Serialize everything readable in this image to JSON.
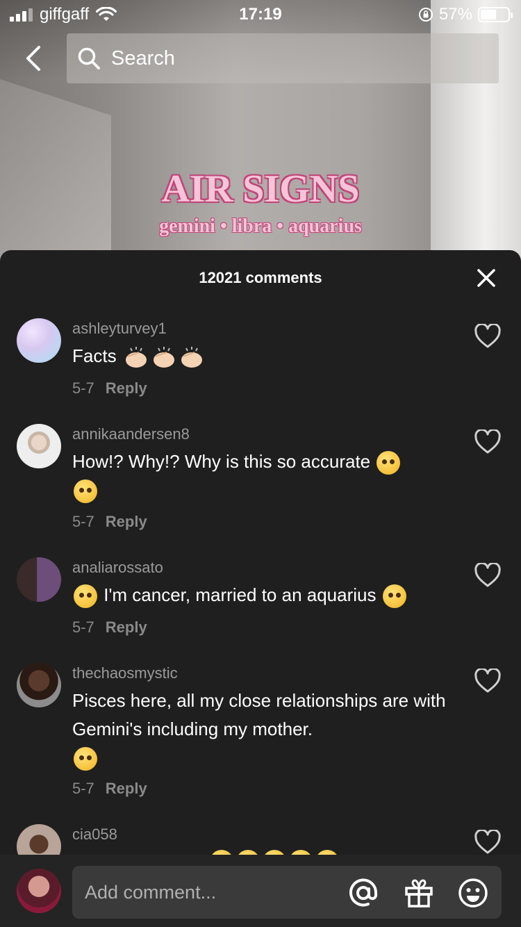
{
  "status_bar": {
    "carrier": "giffgaff",
    "time": "17:19",
    "battery_percent": "57%",
    "battery_level": 0.57
  },
  "nav": {
    "search_placeholder": "Search"
  },
  "video_overlay": {
    "title": "AIR SIGNS",
    "subtitle": "gemini • libra • aquarius"
  },
  "comments_panel": {
    "count_label": "12021 comments",
    "comments": [
      {
        "username": "ashleyturvey1",
        "text": "Facts",
        "date": "5-7",
        "reply_label": "Reply"
      },
      {
        "username": "annikaandersen8",
        "text": "How!? Why!? Why is this so accurate",
        "date": "5-7",
        "reply_label": "Reply"
      },
      {
        "username": "analiarossato",
        "text": "I'm cancer, married to an aquarius",
        "date": "5-7",
        "reply_label": "Reply"
      },
      {
        "username": "thechaosmystic",
        "text": "Pisces here, all my close relationships are with Gemini's including my mother.",
        "date": "5-7",
        "reply_label": "Reply"
      },
      {
        "username": "cia058"
      }
    ]
  },
  "composer": {
    "placeholder": "Add comment..."
  },
  "colors": {
    "sheet_bg": "#1f1f1f",
    "overlay_pink": "#f6c4d8",
    "overlay_outline": "#c2457a"
  }
}
